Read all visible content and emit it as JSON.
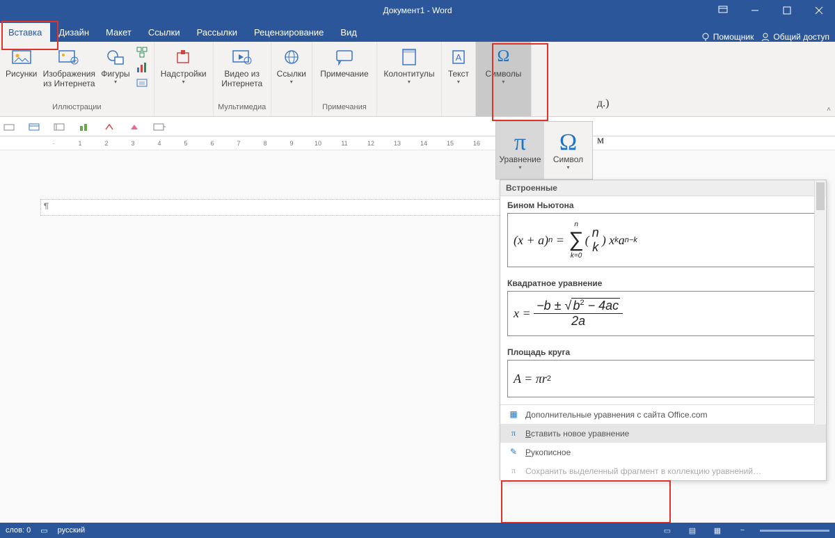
{
  "title": "Документ1 - Word",
  "tabs": {
    "insert": "Вставка",
    "design": "Дизайн",
    "layout": "Макет",
    "refs": "Ссылки",
    "mail": "Рассылки",
    "review": "Рецензирование",
    "view": "Вид",
    "tell": "Помощник",
    "share": "Общий доступ"
  },
  "ribbon": {
    "pictures": "Рисунки",
    "online_images": "Изображения из Интернета",
    "shapes": "Фигуры",
    "illustrations_group": "Иллюстрации",
    "addins": "Надстройки",
    "online_video": "Видео из Интернета",
    "multimedia_group": "Мультимедиа",
    "links": "Ссылки",
    "comment": "Примечание",
    "comments_group": "Примечания",
    "header_footer": "Колонтитулы",
    "text": "Текст",
    "symbols": "Символы"
  },
  "sym_sub": {
    "equation": "Уравнение",
    "symbol": "Символ"
  },
  "equation_gallery": {
    "header": "Встроенные",
    "items": [
      {
        "title": "Бином Ньютона"
      },
      {
        "title": "Квадратное уравнение"
      },
      {
        "title": "Площадь круга"
      }
    ],
    "more_office": "Дополнительные уравнения с сайта Office.com",
    "insert_new": "Вставить новое уравнение",
    "ink": "Рукописное",
    "save_sel": "Сохранить выделенный фрагмент в коллекцию уравнений…"
  },
  "tooltip": "Вставить новое уравнение",
  "side_text": {
    "a": "д.)",
    "b": "м"
  },
  "status": {
    "words_lbl": "слов:",
    "words": "0",
    "lang": "русский"
  },
  "doc_para": "¶"
}
